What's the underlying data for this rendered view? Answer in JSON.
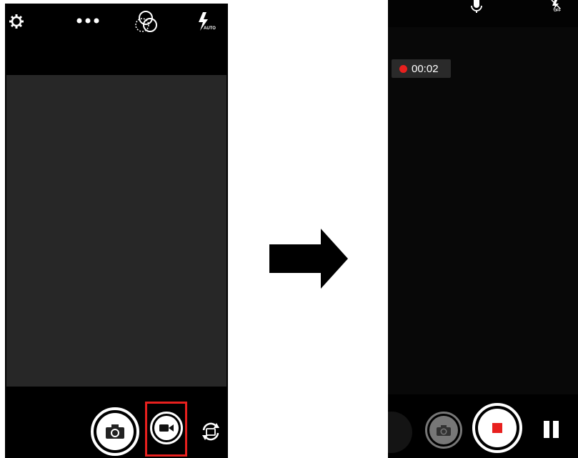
{
  "left_screen": {
    "top_icons": [
      "settings-icon",
      "more-icon",
      "filter-icon",
      "flash-auto-icon"
    ],
    "flash_mode": "AUTO",
    "bottom_buttons": [
      "photo-shutter-button",
      "video-mode-button",
      "switch-camera-button"
    ]
  },
  "right_screen": {
    "top_icons": [
      "microphone-icon",
      "flash-off-icon"
    ],
    "flash_mode": "OFF",
    "recording_time": "00:02",
    "bottom_buttons": [
      "photo-capture-button",
      "stop-record-button",
      "pause-button"
    ]
  },
  "colors": {
    "record_red": "#e8201e",
    "preview_gray": "#272727",
    "highlight_border": "#e8201e"
  }
}
